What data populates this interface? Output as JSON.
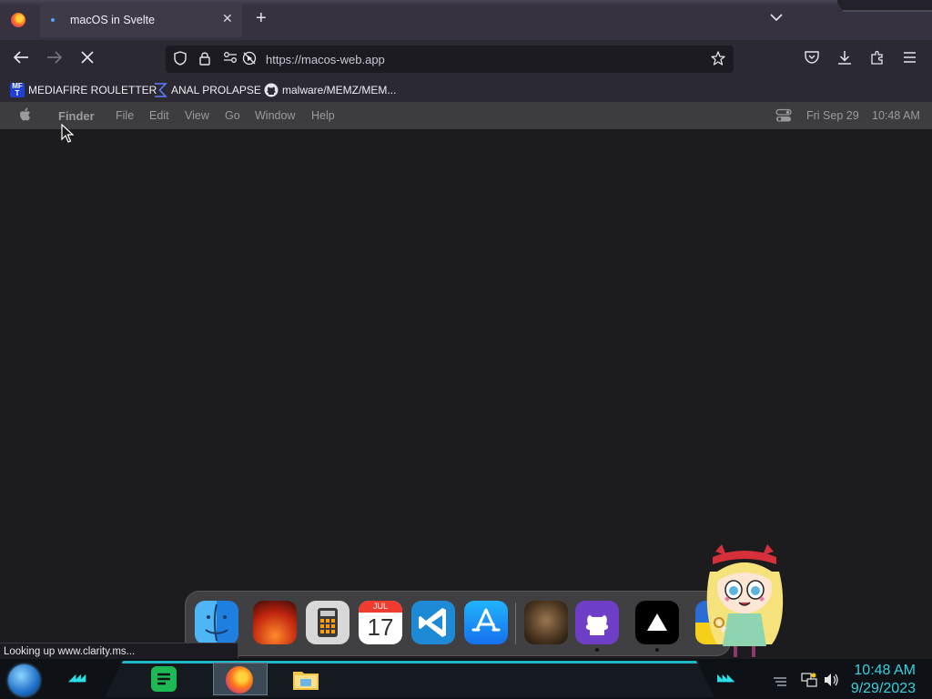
{
  "browser": {
    "tab": {
      "title": "macOS in Svelte"
    },
    "url": "https://macos-web.app",
    "status": "Looking up www.clarity.ms...",
    "bookmarks": [
      {
        "label": "MEDIAFIRE ROULETTER",
        "icon": "mft-icon"
      },
      {
        "label": "ANAL PROLAPSE",
        "icon": "sigma-icon"
      },
      {
        "label": "malware/MEMZ/MEM...",
        "icon": "github-icon"
      }
    ]
  },
  "macos": {
    "menubar": {
      "app": "Finder",
      "items": [
        "File",
        "Edit",
        "View",
        "Go",
        "Window",
        "Help"
      ],
      "date": "Fri Sep 29",
      "time": "10:48 AM"
    },
    "dock": {
      "calendar_month": "JUL",
      "calendar_day": "17",
      "apps": [
        "finder-icon",
        "ventura-wallpaper-icon",
        "calculator-icon",
        "calendar-icon",
        "vscode-icon",
        "app-store-icon",
        "cat-photo-icon",
        "github-app-icon",
        "vercel-icon",
        "ukraine-flag-icon"
      ]
    }
  },
  "taskbar": {
    "time": "10:48 AM",
    "date": "9/29/2023"
  },
  "colors": {
    "accent": "#2ae0e8",
    "menubar": "#3d3d3f",
    "desktop": "#1c1c1e"
  }
}
